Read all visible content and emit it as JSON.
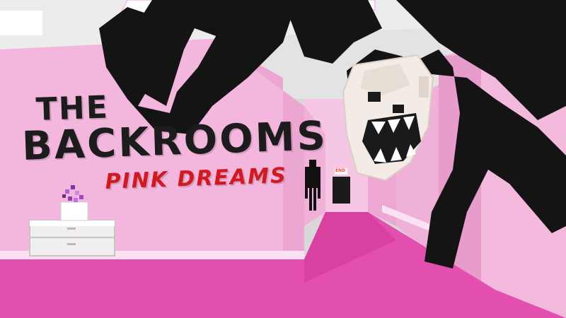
{
  "title": {
    "line1": "THE",
    "line2": "BACKROOMS",
    "line3": "PINK DREAMS"
  },
  "scene": {
    "exit_sign": "END",
    "colors": {
      "wall_pink": "#f3b6dc",
      "wall_shadow": "#e7a0cd",
      "floor_pink": "#e34fae",
      "ceiling": "#dcdcdc",
      "light_panel": "#ffffff",
      "creature_black": "#141414",
      "title_black": "#1c1c1c",
      "title_red": "#d4181f"
    },
    "icons": [
      "ceiling-light-icon",
      "creature-icon",
      "skull-head-icon",
      "cabinet-icon",
      "plant-icon",
      "stick-figure-icon"
    ]
  }
}
